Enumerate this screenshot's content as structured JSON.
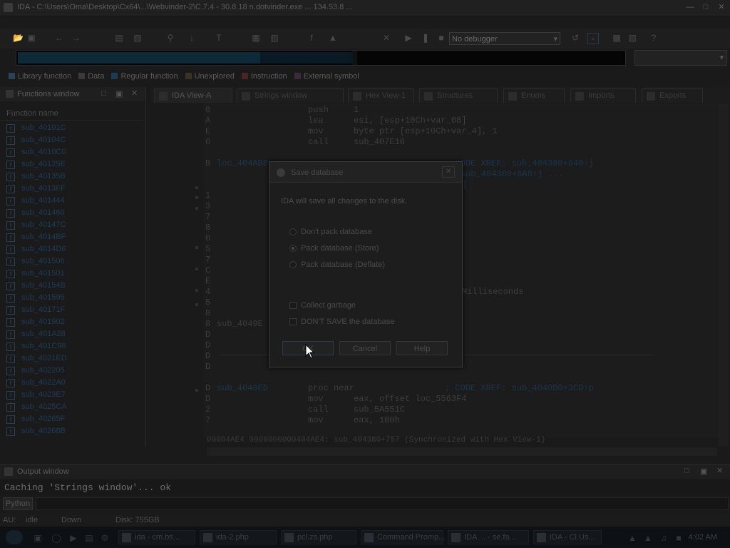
{
  "window": {
    "title": "IDA - C:\\Users\\Oma\\Desktop\\Cx64\\...\\Webvinder-2\\C.7.4 - 30.8.18 n.dotvinder.exe ... 134.53.8 ..."
  },
  "toolbar": {
    "debugger_select": "No debugger"
  },
  "legend": [
    {
      "label": "Library function",
      "color": "#2a4356"
    },
    {
      "label": "Data",
      "color": "#3a3a3a"
    },
    {
      "label": "Regular function",
      "color": "#1d3b52"
    },
    {
      "label": "Unexplored",
      "color": "#3a3324"
    },
    {
      "label": "Instruction",
      "color": "#4a2525"
    },
    {
      "label": "External symbol",
      "color": "#3a2a3a"
    }
  ],
  "functions_window": {
    "title": "Functions window",
    "column": "Function name",
    "items": [
      "sub_40101C",
      "sub_40104C",
      "sub_4010C0",
      "sub_40125E",
      "sub_40135B",
      "sub_4013FF",
      "sub_401444",
      "sub_401460",
      "sub_40147C",
      "sub_4014BF",
      "sub_4014D6",
      "sub_401506",
      "sub_401501",
      "sub_40154B",
      "sub_401595",
      "sub_40171F",
      "sub_401902",
      "sub_401A28",
      "sub_401C98",
      "sub_4021ED",
      "sub_402205",
      "sub_4022A0",
      "sub_4023E7",
      "sub_4025CA",
      "sub_40265F",
      "sub_40268B"
    ]
  },
  "tabs": [
    "IDA View-A",
    "Strings window",
    "Hex View-1",
    "Structures",
    "Enums",
    "Imports",
    "Exports"
  ],
  "disasm": {
    "lines": [
      {
        "addr": "8",
        "label": "",
        "op": "push",
        "args": "1",
        "comment": ""
      },
      {
        "addr": "A",
        "label": "",
        "op": "lea",
        "args": "esi, [esp+10Ch+var_08]",
        "comment": ""
      },
      {
        "addr": "E",
        "label": "",
        "op": "mov",
        "args": "byte ptr [esp+10Ch+var_4], 1",
        "comment": ""
      },
      {
        "addr": "6",
        "label": "",
        "op": "call",
        "args": "sub_407E16",
        "comment": ""
      },
      {
        "addr": "B",
        "label": "loc_404AB8:",
        "op": "",
        "args": "",
        "comment": "; CODE XREF: sub_404380+640↑j"
      },
      {
        "addr": "",
        "label": "",
        "op": "",
        "args": "",
        "comment": "sub_404380+6A8↑j ..."
      }
    ],
    "ellipsis_text": "]",
    "milliseconds_text": "Milliseconds",
    "sub_label": "sub_4049E",
    "lower": [
      {
        "addr": "D",
        "label": "sub_4040ED",
        "op": "proc near",
        "args": "",
        "comment": "; CODE XREF: sub_4040B0+3CD↑p"
      },
      {
        "addr": "D",
        "label": "",
        "op": "mov",
        "args": "eax, offset loc_5563F4",
        "comment": ""
      },
      {
        "addr": "2",
        "label": "",
        "op": "call",
        "args": "sub_5A551C",
        "comment": ""
      },
      {
        "addr": "7",
        "label": "",
        "op": "mov",
        "args": "eax, 1B0h",
        "comment": ""
      }
    ],
    "left_addrs": [
      "1",
      "3",
      "7",
      "8",
      "0",
      "5",
      "7",
      "C",
      "E",
      "4",
      "5",
      "8"
    ],
    "addrs_lower": [
      "8",
      "D",
      "D",
      "D",
      "D"
    ],
    "status": "00004AE4 0000000000404AE4: sub_404380+757 (Synchronized with Hex View-1)"
  },
  "dialog": {
    "title": "Save database",
    "message": "IDA will save all changes to the disk.",
    "options": [
      {
        "label": "Don't pack database",
        "selected": false
      },
      {
        "label": "Pack database (Store)",
        "selected": true
      },
      {
        "label": "Pack database (Deflate)",
        "selected": false
      }
    ],
    "checks": [
      {
        "label": "Collect garbage"
      },
      {
        "label": "DON'T SAVE the database"
      }
    ],
    "buttons": {
      "ok": "OK",
      "cancel": "Cancel",
      "help": "Help"
    }
  },
  "output": {
    "title": "Output window",
    "text": "Caching 'Strings window'... ok",
    "python_btn": "Python"
  },
  "statusbar": {
    "au": "AU:",
    "state": "idle",
    "dir": "Down",
    "disk": "Disk: 755GB"
  },
  "taskbar": {
    "items": [
      "ida - cm.bs...",
      "ida-2.php",
      "pcl.zs.php",
      "Command Promp...",
      "IDA ... - se.fa...",
      "IDA - Cl.Us..."
    ],
    "clock": "4:02 AM"
  }
}
